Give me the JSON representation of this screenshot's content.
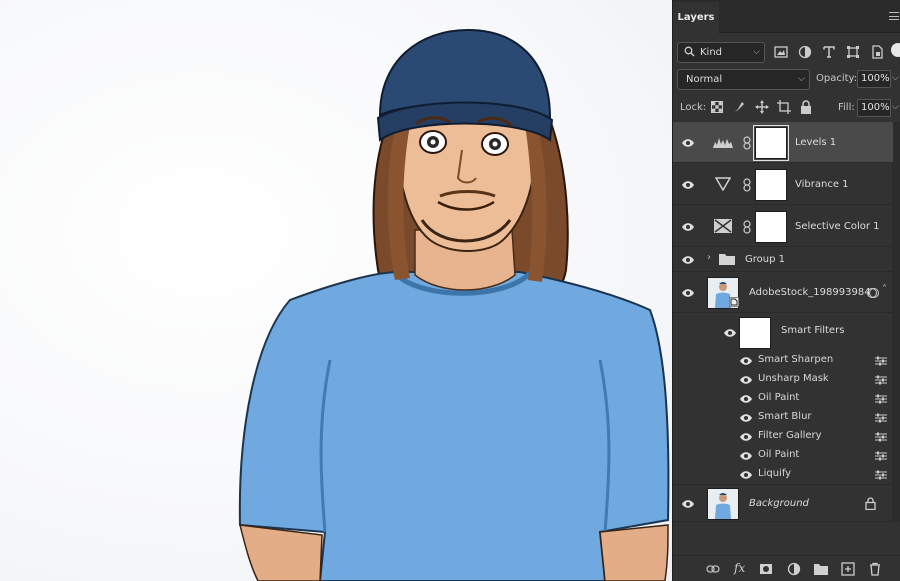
{
  "panel": {
    "tab_label": "Layers",
    "kind_label": "Kind",
    "blend_mode": "Normal",
    "opacity_label": "Opacity:",
    "opacity_value": "100%",
    "lock_label": "Lock:",
    "fill_label": "Fill:",
    "fill_value": "100%"
  },
  "layers": [
    {
      "name": "Levels 1",
      "type": "adjustment",
      "icon": "levels-icon",
      "selected": true
    },
    {
      "name": "Vibrance 1",
      "type": "adjustment",
      "icon": "vibrance-icon"
    },
    {
      "name": "Selective Color 1",
      "type": "adjustment",
      "icon": "selective-color-icon"
    },
    {
      "name": "Group 1",
      "type": "group",
      "icon": "folder-icon"
    },
    {
      "name": "AdobeStock_198993984",
      "type": "smart-object"
    },
    {
      "name": "Smart Filters",
      "type": "smart-filters"
    },
    {
      "name": "Background",
      "type": "background",
      "locked": true
    }
  ],
  "smart_filters": [
    "Smart Sharpen",
    "Unsharp Mask",
    "Oil Paint",
    "Smart Blur",
    "Filter Gallery",
    "Oil Paint",
    "Liquify"
  ],
  "bottom_icons": [
    "link-icon",
    "fx-icon",
    "mask-icon",
    "adjustment-icon",
    "new-group-icon",
    "new-layer-icon",
    "trash-icon"
  ],
  "bottom_fx_label": "fx",
  "colors": {
    "panel_bg": "#323232",
    "selected_row": "#4a4a4a",
    "shirt": "#6fa9df",
    "beanie": "#2b4a73",
    "hair": "#7a4a2a"
  }
}
